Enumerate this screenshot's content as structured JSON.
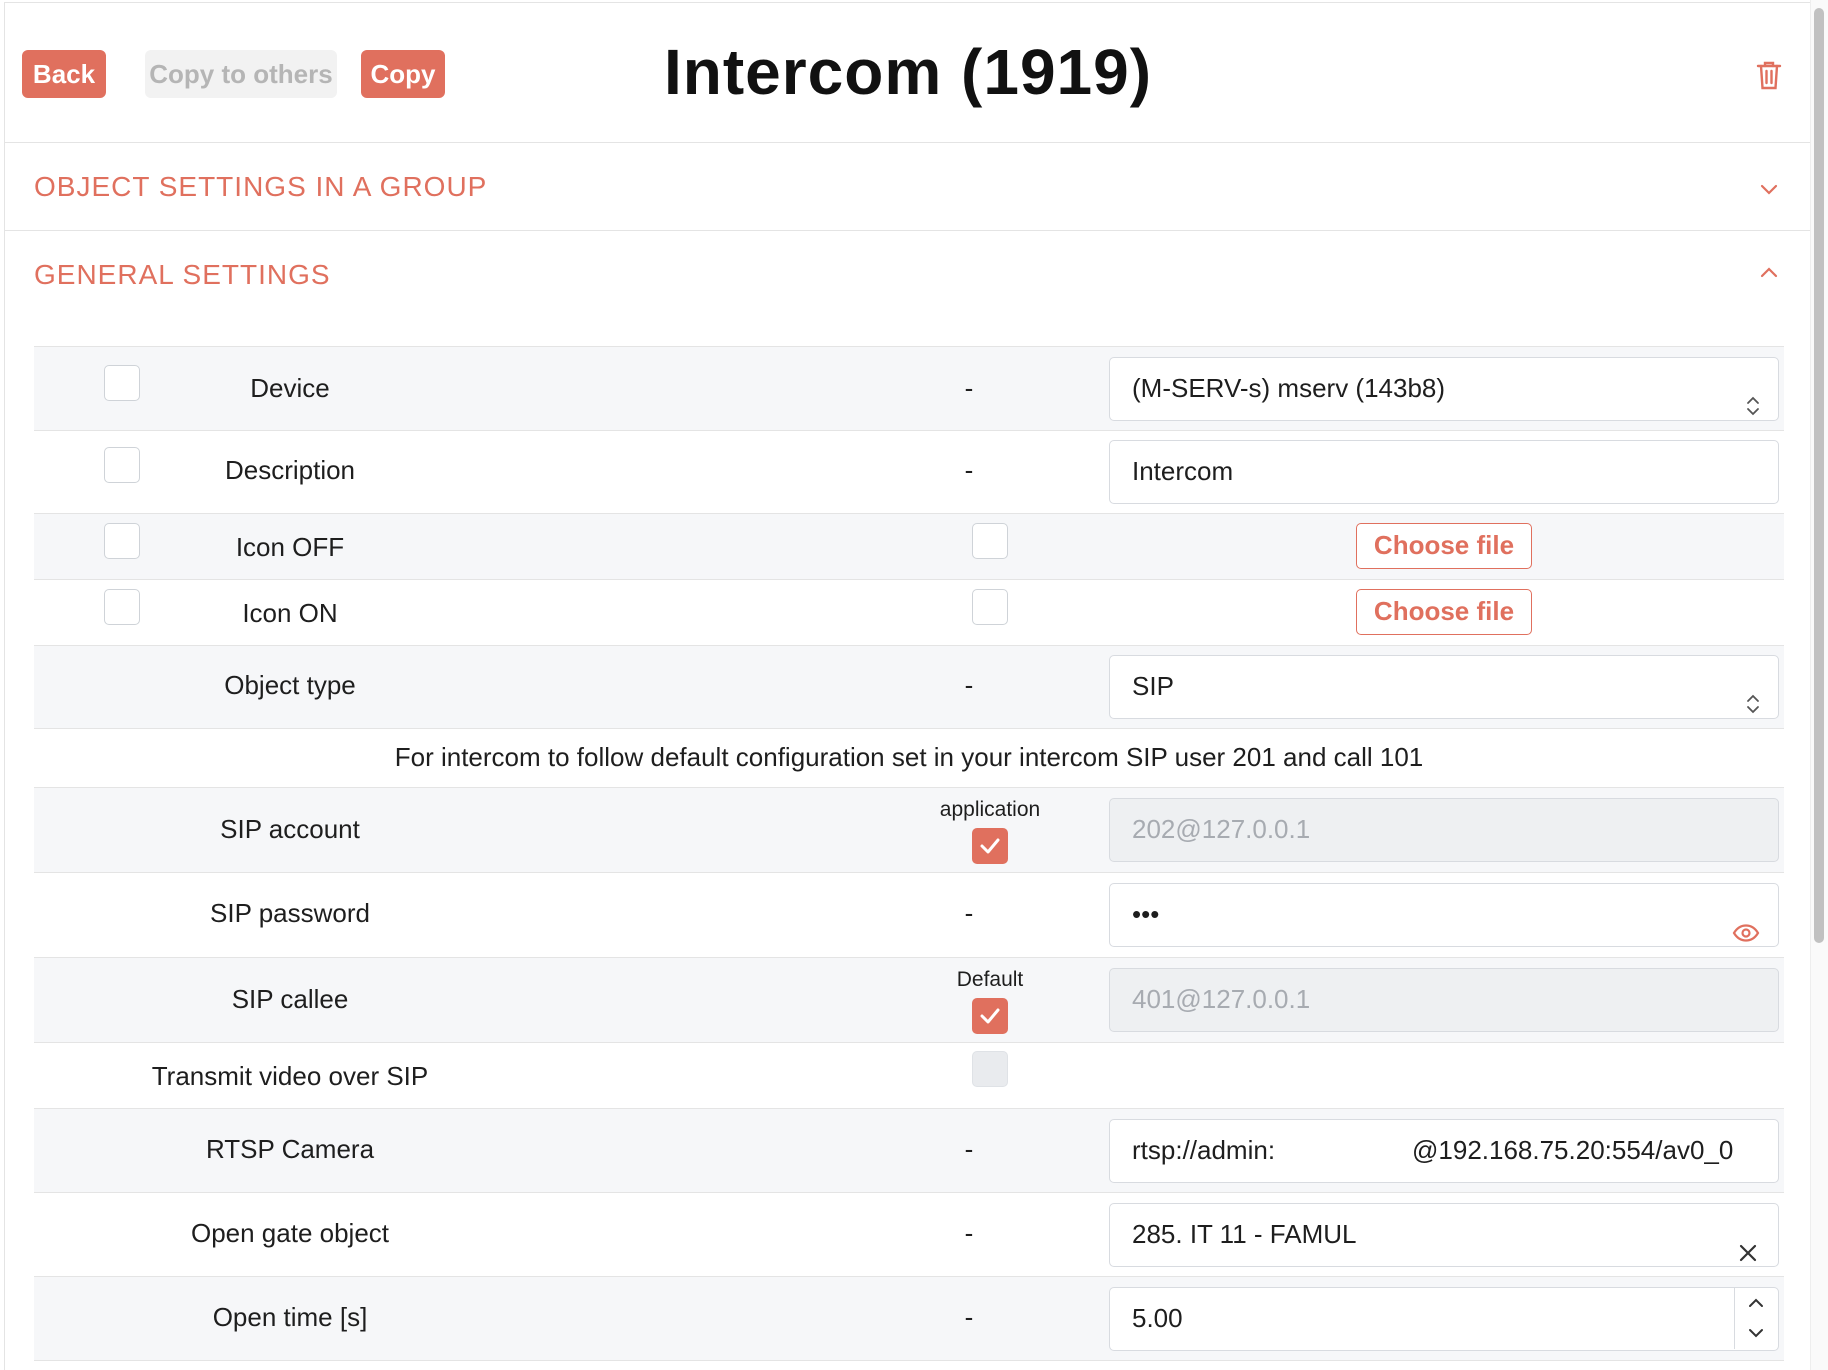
{
  "header": {
    "back_label": "Back",
    "copy_to_others_label": "Copy to others",
    "copy_label": "Copy",
    "title": "Intercom (1919)"
  },
  "sections": {
    "group_settings": "OBJECT SETTINGS IN A GROUP",
    "general_settings": "GENERAL SETTINGS"
  },
  "rows": {
    "device": {
      "label": "Device",
      "mid": "-",
      "value": "(M-SERV-s) mserv (143b8)"
    },
    "description": {
      "label": "Description",
      "mid": "-",
      "value": "Intercom"
    },
    "icon_off": {
      "label": "Icon OFF",
      "button": "Choose file"
    },
    "icon_on": {
      "label": "Icon ON",
      "button": "Choose file"
    },
    "object_type": {
      "label": "Object type",
      "mid": "-",
      "value": "SIP"
    },
    "note": "For intercom to follow default configuration set in your intercom SIP user 201 and call 101",
    "sip_account": {
      "label": "SIP account",
      "caption": "application",
      "value": "202@127.0.0.1"
    },
    "sip_password": {
      "label": "SIP password",
      "mid": "-",
      "value": "•••"
    },
    "sip_callee": {
      "label": "SIP callee",
      "caption": "Default",
      "value": "401@127.0.0.1"
    },
    "transmit_video": {
      "label": "Transmit video over SIP"
    },
    "rtsp_camera": {
      "label": "RTSP Camera",
      "mid": "-",
      "value_user": "rtsp://admin:",
      "value_host": "@192.168.75.20:554/av0_0"
    },
    "open_gate": {
      "label": "Open gate object",
      "mid": "-",
      "value": "285. IT 11 - FAMUL"
    },
    "open_time": {
      "label": "Open time [s]",
      "mid": "-",
      "value": "5.00"
    }
  },
  "colors": {
    "accent": "#e0705e",
    "row_alt": "#f6f7f9",
    "border": "#e4e4e4"
  },
  "icons": [
    "trash-icon",
    "chevron-down-icon",
    "chevron-up-icon",
    "select-arrows-icon",
    "eye-icon",
    "clear-icon",
    "check-icon",
    "spinner-up-icon",
    "spinner-down-icon"
  ]
}
